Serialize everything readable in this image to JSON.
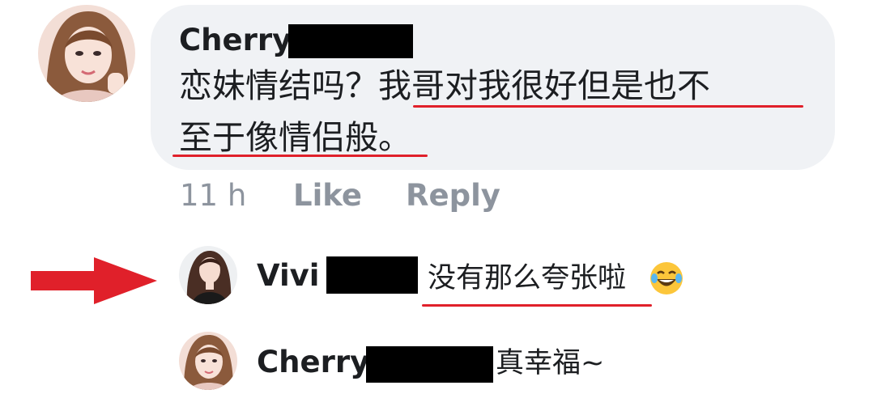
{
  "comment": {
    "author": "Cherry",
    "text_line1": "恋妹情结吗？我哥对我很好但是也不",
    "text_line2": "至于像情侣般。",
    "time": "11 h",
    "like_label": "Like",
    "reply_label": "Reply",
    "avatar_icon": "profile-photo"
  },
  "replies": [
    {
      "author": "Vivi",
      "text": "没有那么夸张啦",
      "emoji": "laughing-crying-emoji",
      "avatar_icon": "profile-photo"
    },
    {
      "author": "Cherry",
      "text": "真幸福~",
      "avatar_icon": "profile-photo"
    }
  ],
  "annotations": {
    "arrow_color": "#e0202a",
    "underline_color": "#e0202a",
    "redaction_color": "#000000"
  },
  "colors": {
    "bubble_bg": "#f0f2f5",
    "text": "#1c1e21",
    "muted": "#8d949e"
  }
}
